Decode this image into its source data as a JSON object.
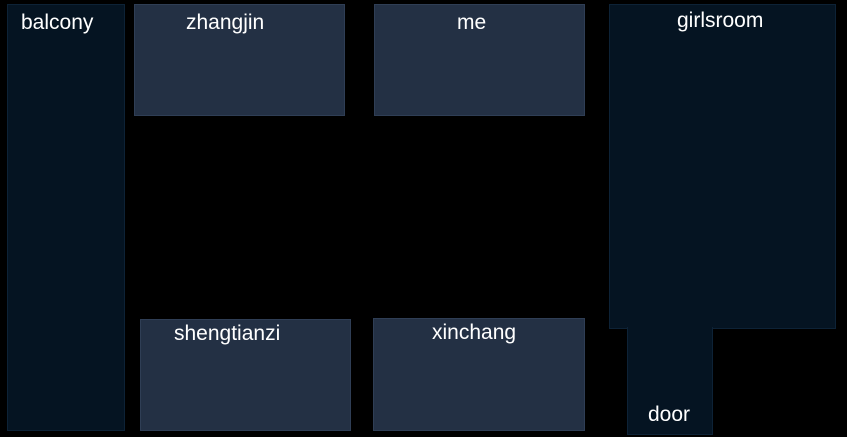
{
  "floorplan": {
    "colors": {
      "background": "#000000",
      "dark_room": "#051422",
      "slate_room": "#233044",
      "label": "#ffffff"
    },
    "rooms": {
      "balcony": "balcony",
      "zhangjin": "zhangjin",
      "me": "me",
      "girlsroom": "girlsroom",
      "shengtianzi": "shengtianzi",
      "xinchang": "xinchang",
      "door": "door"
    }
  }
}
